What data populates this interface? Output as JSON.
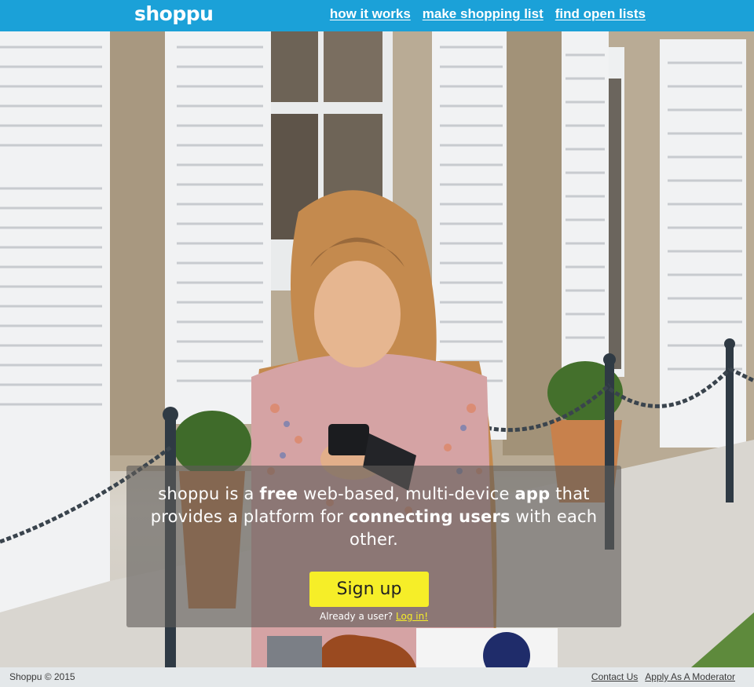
{
  "header": {
    "brand": "shoppu",
    "nav": [
      {
        "label": "how it works"
      },
      {
        "label": "make shopping list"
      },
      {
        "label": "find open lists"
      }
    ]
  },
  "hero": {
    "pitch": {
      "p1": "shoppu is a ",
      "b1": "free",
      "p2": " web-based, multi-device ",
      "b2": "app",
      "p3": " that provides a platform for ",
      "b3": "connecting users",
      "p4": " with each other."
    },
    "signup_label": "Sign up",
    "already_text": "Already a user?",
    "login_label": "Log in!"
  },
  "footer": {
    "copyright": "Shoppu © 2015",
    "links": [
      {
        "label": "Contact Us"
      },
      {
        "label": "Apply As A Moderator"
      }
    ]
  },
  "colors": {
    "topbar": "#1ba1d8",
    "signup_button": "#f6ee28",
    "login_link": "#f6ee28",
    "footer": "#e4e8ea"
  }
}
